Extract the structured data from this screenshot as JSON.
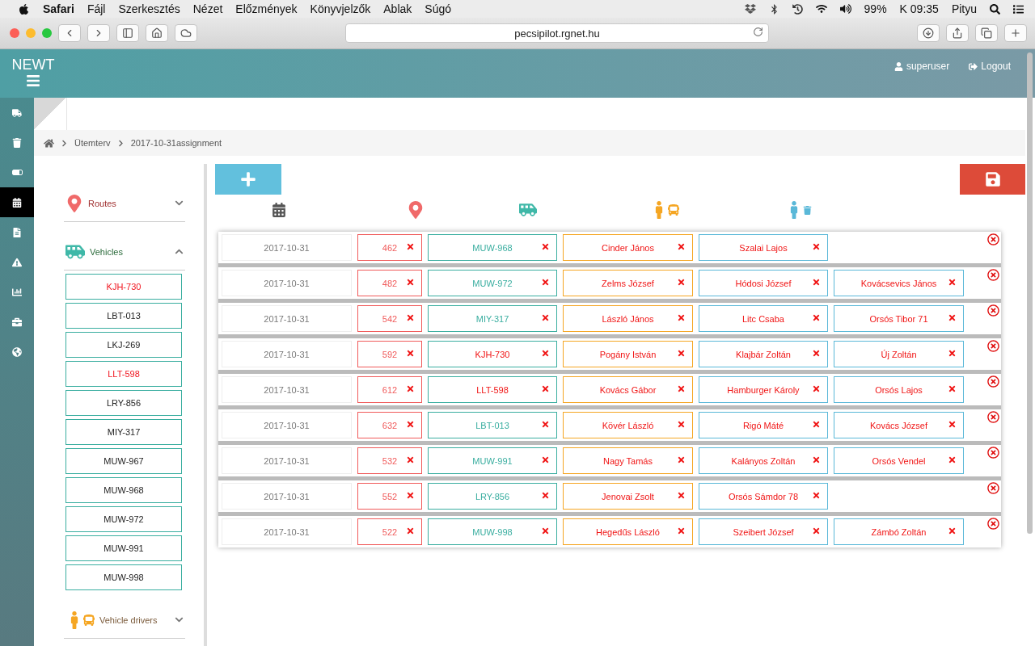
{
  "menubar": {
    "app": "Safari",
    "items": [
      "Fájl",
      "Szerkesztés",
      "Nézet",
      "Előzmények",
      "Könyvjelzők",
      "Ablak",
      "Súgó"
    ],
    "battery": "99%",
    "clock": "K 09:35",
    "user": "Pityu"
  },
  "browser": {
    "url": "pecsipilot.rgnet.hu"
  },
  "header": {
    "logo": "NEWT",
    "user": "superuser",
    "logout": "Logout"
  },
  "nav": [
    {
      "selected": false
    },
    {
      "selected": false
    },
    {
      "selected": false
    },
    {
      "selected": true
    },
    {
      "selected": false
    },
    {
      "selected": false
    },
    {
      "selected": false
    },
    {
      "selected": false
    },
    {
      "selected": false
    }
  ],
  "breadcrumb": [
    "Ütemterv",
    "2017-10-31assignment"
  ],
  "sidebar": {
    "sections": [
      {
        "kind": "routes",
        "title": "Routes",
        "expanded": false
      },
      {
        "kind": "vehicles",
        "title": "Vehicles",
        "expanded": true,
        "items": [
          {
            "label": "KJH-730",
            "flagged": true
          },
          {
            "label": "LBT-013",
            "flagged": false
          },
          {
            "label": "LKJ-269",
            "flagged": false
          },
          {
            "label": "LLT-598",
            "flagged": true
          },
          {
            "label": "LRY-856",
            "flagged": false
          },
          {
            "label": "MIY-317",
            "flagged": false
          },
          {
            "label": "MUW-967",
            "flagged": false
          },
          {
            "label": "MUW-968",
            "flagged": false
          },
          {
            "label": "MUW-972",
            "flagged": false
          },
          {
            "label": "MUW-991",
            "flagged": false
          },
          {
            "label": "MUW-998",
            "flagged": false
          }
        ]
      },
      {
        "kind": "drivers",
        "title": "Vehicle drivers",
        "expanded": false
      }
    ]
  },
  "rows": [
    {
      "date": "2017-10-31",
      "route": "462",
      "vehicle": {
        "label": "MUW-968",
        "flagged": false
      },
      "driver": "Cinder János",
      "loaders": [
        "Szalai Lajos"
      ]
    },
    {
      "date": "2017-10-31",
      "route": "482",
      "vehicle": {
        "label": "MUW-972",
        "flagged": false
      },
      "driver": "Zelms József",
      "loaders": [
        "Hódosi József",
        "Kovácsevics János"
      ]
    },
    {
      "date": "2017-10-31",
      "route": "542",
      "vehicle": {
        "label": "MIY-317",
        "flagged": false
      },
      "driver": "László János",
      "loaders": [
        "Litc Csaba",
        "Orsós Tibor 71"
      ]
    },
    {
      "date": "2017-10-31",
      "route": "592",
      "vehicle": {
        "label": "KJH-730",
        "flagged": true
      },
      "driver": "Pogány István",
      "loaders": [
        "Klajbár Zoltán",
        "Új Zoltán"
      ]
    },
    {
      "date": "2017-10-31",
      "route": "612",
      "vehicle": {
        "label": "LLT-598",
        "flagged": true
      },
      "driver": "Kovács Gábor",
      "loaders": [
        "Hamburger Károly",
        "Orsós Lajos"
      ]
    },
    {
      "date": "2017-10-31",
      "route": "632",
      "vehicle": {
        "label": "LBT-013",
        "flagged": false
      },
      "driver": "Kövér László",
      "loaders": [
        "Rigó Máté",
        "Kovács József"
      ]
    },
    {
      "date": "2017-10-31",
      "route": "532",
      "vehicle": {
        "label": "MUW-991",
        "flagged": false
      },
      "driver": "Nagy Tamás",
      "loaders": [
        "Kalányos Zoltán",
        "Orsós Vendel"
      ]
    },
    {
      "date": "2017-10-31",
      "route": "552",
      "vehicle": {
        "label": "LRY-856",
        "flagged": false
      },
      "driver": "Jenovai Zsolt",
      "loaders": [
        "Orsós Sámdor 78"
      ]
    },
    {
      "date": "2017-10-31",
      "route": "522",
      "vehicle": {
        "label": "MUW-998",
        "flagged": false
      },
      "driver": "Hegedűs László",
      "loaders": [
        "Szeibert József",
        "Zámbó Zoltán"
      ]
    }
  ]
}
